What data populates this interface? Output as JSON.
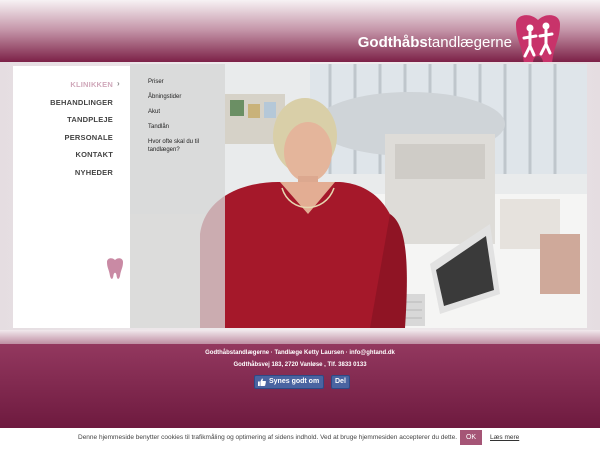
{
  "header": {
    "brand_bold": "Godthåbs",
    "brand_light": "tandlægerne"
  },
  "nav": {
    "items": [
      {
        "label": "KLINIKKEN",
        "active": true
      },
      {
        "label": "BEHANDLINGER"
      },
      {
        "label": "TANDPLEJE"
      },
      {
        "label": "PERSONALE"
      },
      {
        "label": "KONTAKT"
      },
      {
        "label": "NYHEDER"
      }
    ],
    "arrow": "›"
  },
  "subnav": {
    "items": [
      {
        "label": "Priser"
      },
      {
        "label": "Åbningstider"
      },
      {
        "label": "Akut"
      },
      {
        "label": "Tandlån"
      },
      {
        "label": "Hvor ofte skal du til tandlægen?"
      }
    ]
  },
  "footer": {
    "line1": "Godthåbstandlægerne · Tandlæge Ketty Laursen · info@ghtand.dk",
    "line2": "Godthåbsvej 183, 2720 Vanløse , Tlf. 3833 0133",
    "like_label": "Synes godt om",
    "share_label": "Del"
  },
  "cookie": {
    "text": "Denne hjemmeside benytter cookies til trafikmåling og optimering af sidens indhold. Ved at bruge hjemmesiden accepterer du dette.",
    "ok_label": "OK",
    "more_label": "Læs mere"
  },
  "colors": {
    "brand": "#7c2147",
    "accent": "#a55576",
    "facebook": "#4a64a1"
  },
  "icons": [
    "tooth-logo-icon",
    "facebook-thumb-icon"
  ]
}
